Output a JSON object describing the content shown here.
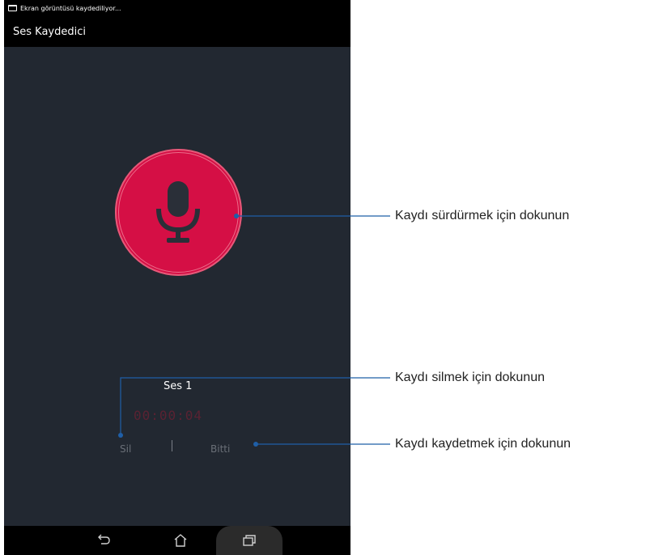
{
  "statusbar": {
    "notification": "Ekran görüntüsü kaydediliyor..."
  },
  "appbar": {
    "title": "Ses Kaydedici"
  },
  "recorder": {
    "track_name": "Ses 1",
    "timer": "00:00:04",
    "delete_label": "Sil",
    "separator": "|",
    "done_label": "Bitti"
  },
  "navbar": {
    "back": "back-icon",
    "home": "home-icon",
    "recents": "recents-icon"
  },
  "callouts": {
    "resume": "Kaydı sürdürmek için dokunun",
    "delete": "Kaydı silmek için dokunun",
    "save": "Kaydı kaydetmek için dokunun"
  },
  "colors": {
    "record_button": "#d50f45",
    "background": "#222831",
    "callout_line": "#1f5fa8"
  }
}
